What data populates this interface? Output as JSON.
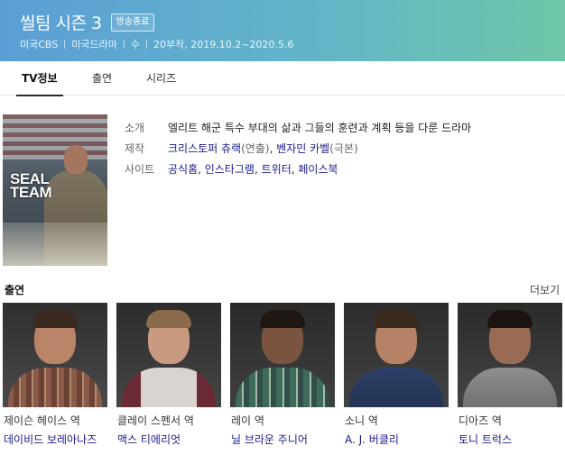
{
  "header": {
    "title": "씰팀 시즌 3",
    "badge": "방송종료",
    "meta": [
      "미국CBS",
      "미국드라마",
      "수",
      "20부작, 2019.10.2~2020.5.6"
    ],
    "colors": {
      "gradient_start": "#5b9ed6",
      "gradient_end": "#6fc6a8"
    }
  },
  "tabs": [
    {
      "label": "TV정보",
      "active": true
    },
    {
      "label": "출연",
      "active": false
    },
    {
      "label": "시리즈",
      "active": false
    }
  ],
  "poster": {
    "logo_line1": "SEAL",
    "logo_line2": "TEAM"
  },
  "info": {
    "intro_label": "소개",
    "intro_value": "엘리트 해군 특수 부대의 삶과 그들의 훈련과 계획 등을 다룬 드라마",
    "production_label": "제작",
    "producer1": "크리스토퍼 츄랙",
    "producer1_role": "(연출)",
    "producer2": "벤자민 카벨",
    "producer2_role": "(극본)",
    "site_label": "사이트",
    "sites": [
      "공식홈",
      "인스타그램",
      "트위터",
      "페이스북"
    ]
  },
  "cast": {
    "title": "출연",
    "more_label": "더보기",
    "members": [
      {
        "role": "제이슨 헤이스 역",
        "actor": "데이비드 보레아나즈"
      },
      {
        "role": "클레이 스펜서 역",
        "actor": "맥스 티에리엇"
      },
      {
        "role": "레이 역",
        "actor": "닐 브라운 주니어"
      },
      {
        "role": "소니 역",
        "actor": "A. J. 버클리"
      },
      {
        "role": "디아즈 역",
        "actor": "토니 트럭스"
      }
    ]
  }
}
